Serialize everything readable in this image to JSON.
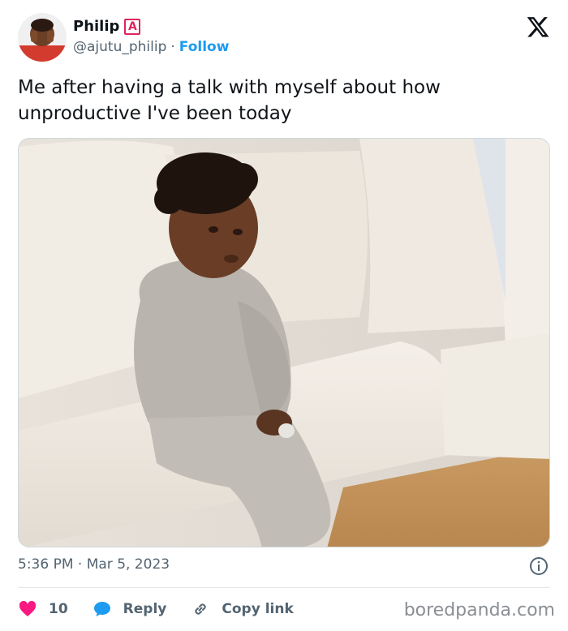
{
  "header": {
    "display_name": "Philip",
    "badge_letter": "A",
    "handle": "@ajutu_philip",
    "separator": "·",
    "follow_label": "Follow",
    "x_logo_icon": "x-logo-icon"
  },
  "tweet": {
    "text": "Me after having a talk with myself about how unproductive I've been today"
  },
  "meta": {
    "timestamp": "5:36 PM · Mar 5, 2023",
    "info_icon": "info-icon"
  },
  "actions": {
    "like_count": "10",
    "reply_label": "Reply",
    "copy_link_label": "Copy link"
  },
  "watermark": "boredpanda.com",
  "colors": {
    "link_blue": "#1d9bf0",
    "like_red": "#f91880",
    "badge_red": "#e0245e",
    "muted_gray": "#536471"
  }
}
